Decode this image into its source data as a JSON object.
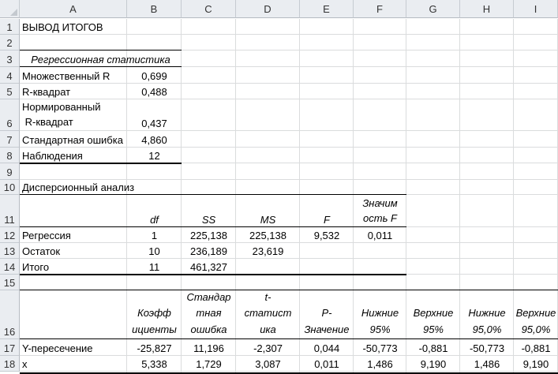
{
  "columns": [
    "A",
    "B",
    "C",
    "D",
    "E",
    "F",
    "G",
    "H",
    "I"
  ],
  "rows": [
    "1",
    "2",
    "3",
    "4",
    "5",
    "6",
    "7",
    "8",
    "9",
    "10",
    "11",
    "12",
    "13",
    "14",
    "15",
    "16",
    "17",
    "18"
  ],
  "sheet": {
    "title": "ВЫВОД ИТОГОВ",
    "regression_stats": {
      "header": "Регрессионная статистика",
      "multiple_r": {
        "label": "Множественный R",
        "value": "0,699"
      },
      "r_square": {
        "label": "R-квадрат",
        "value": "0,488"
      },
      "adj_r_square": {
        "label_line1": "Нормированный",
        "label_line2": " R-квадрат",
        "value": "0,437"
      },
      "std_error": {
        "label": "Стандартная ошибка",
        "value": "4,860"
      },
      "observations": {
        "label": "Наблюдения",
        "value": "12"
      }
    },
    "anova": {
      "title": "Дисперсионный анализ",
      "headers": {
        "df": "df",
        "ss": "SS",
        "ms": "MS",
        "f": "F",
        "sigf_line1": "Значим",
        "sigf_line2": "ость F"
      },
      "rows": [
        {
          "label": "Регрессия",
          "df": "1",
          "ss": "225,138",
          "ms": "225,138",
          "f": "9,532",
          "sigf": "0,011"
        },
        {
          "label": "Остаток",
          "df": "10",
          "ss": "236,189",
          "ms": "23,619",
          "f": "",
          "sigf": ""
        },
        {
          "label": "Итого",
          "df": "11",
          "ss": "461,327",
          "ms": "",
          "f": "",
          "sigf": ""
        }
      ]
    },
    "coef": {
      "headers": {
        "b": "Коэфф\nициенты",
        "c": "Стандар\nтная\nошибка",
        "d": "t-\nстатист\nика",
        "e": "P-\nЗначение",
        "f": "Нижние\n95%",
        "g": "Верхние\n95%",
        "h": "Нижние\n95,0%",
        "i": "Верхние\n95,0%"
      },
      "rows": [
        {
          "label": "Y-пересечение",
          "b": "-25,827",
          "c": "11,196",
          "d": "-2,307",
          "e": "0,044",
          "f": "-50,773",
          "g": "-0,881",
          "h": "-50,773",
          "i": "-0,881"
        },
        {
          "label": "x",
          "b": "5,338",
          "c": "1,729",
          "d": "3,087",
          "e": "0,011",
          "f": "1,486",
          "g": "9,190",
          "h": "1,486",
          "i": "9,190"
        }
      ]
    }
  }
}
